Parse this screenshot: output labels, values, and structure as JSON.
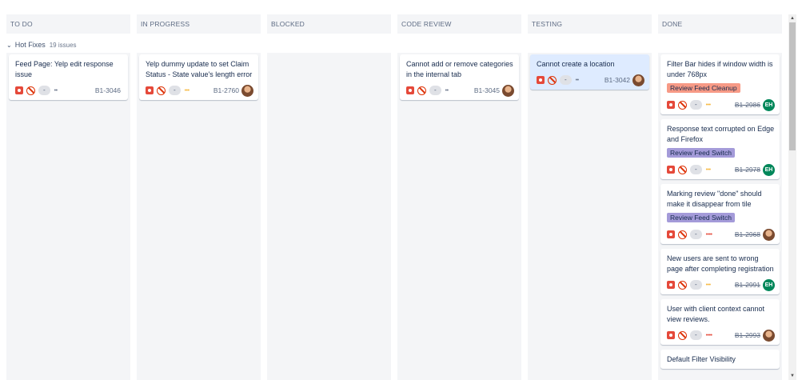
{
  "columns": [
    {
      "title": "TO DO"
    },
    {
      "title": "IN PROGRESS"
    },
    {
      "title": "BLOCKED"
    },
    {
      "title": "CODE REVIEW"
    },
    {
      "title": "TESTING"
    },
    {
      "title": "DONE"
    }
  ],
  "swimlane": {
    "chevron": "⌄",
    "name": "Hot Fixes",
    "count": "19 issues"
  },
  "cards": {
    "todo_0": {
      "title": "Feed Page: Yelp edit response issue",
      "estimate": "-",
      "priority": "••",
      "key": "B1-3046"
    },
    "inprogress_0": {
      "title": "Yelp dummy update to set Claim Status - State value's length error",
      "estimate": "-",
      "priority": "•••",
      "key": "B1-2760"
    },
    "codereview_0": {
      "title": "Cannot add or remove categories in the internal tab",
      "estimate": "-",
      "priority": "••",
      "key": "B1-3045"
    },
    "testing_0": {
      "title": "Cannot create a location",
      "estimate": "-",
      "priority": "••",
      "key": "B1-3042"
    },
    "done_0": {
      "title": "Filter Bar hides if window width is under 768px",
      "epic": "Review Feed Cleanup",
      "estimate": "-",
      "priority": "•••",
      "key": "B1-2986",
      "avatar": "EH"
    },
    "done_1": {
      "title": "Response text corrupted on Edge and Firefox",
      "epic": "Review Feed Switch",
      "estimate": "-",
      "priority": "•••",
      "key": "B1-2978",
      "avatar": "EH"
    },
    "done_2": {
      "title": "Marking review \"done\" should make it disappear from tile",
      "epic": "Review Feed Switch",
      "estimate": "-",
      "priority": "••••",
      "key": "B1-2968"
    },
    "done_3": {
      "title": "New users are sent to wrong page after completing registration",
      "estimate": "-",
      "priority": "•••",
      "key": "B1-2991",
      "avatar": "EH"
    },
    "done_4": {
      "title": "User with client context cannot view reviews.",
      "estimate": "-",
      "priority": "••••",
      "key": "B1-2993"
    },
    "done_5": {
      "title": "Default Filter Visibility"
    }
  },
  "icons": {
    "type": "bug-icon",
    "flag": "blocked-icon",
    "scroll_up": "▲",
    "scroll_down": "▼"
  },
  "colors": {
    "epic_cleanup": "#f79a86",
    "epic_switch": "#a49bd9",
    "priority_medium": "#f6b73c",
    "priority_high": "#e5493a",
    "priority_low": "#6b778c",
    "avatar_green": "#00875a"
  }
}
